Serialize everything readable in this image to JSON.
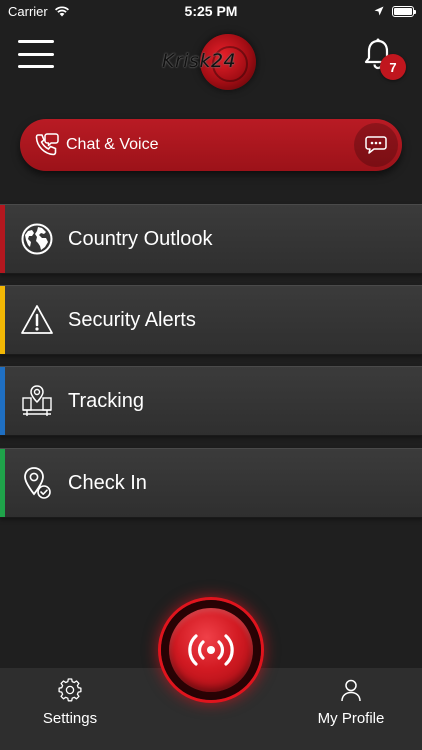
{
  "status_bar": {
    "carrier": "Carrier",
    "time": "5:25 PM",
    "battery_level": 1.0
  },
  "header": {
    "logo_text": "Krisk24",
    "notification_count": "7"
  },
  "chat": {
    "label": "Chat & Voice"
  },
  "menu": {
    "items": [
      {
        "label": "Country Outlook",
        "icon": "globe-icon",
        "accent": "#b3171f"
      },
      {
        "label": "Security Alerts",
        "icon": "warning-icon",
        "accent": "#f2b705"
      },
      {
        "label": "Tracking",
        "icon": "tracking-icon",
        "accent": "#1f6fc2"
      },
      {
        "label": "Check In",
        "icon": "location-check-icon",
        "accent": "#1fa34a"
      }
    ]
  },
  "bottom_nav": {
    "settings_label": "Settings",
    "profile_label": "My Profile"
  },
  "colors": {
    "brand_red": "#c0161e",
    "background": "#1f1f1f",
    "card": "#363636"
  }
}
